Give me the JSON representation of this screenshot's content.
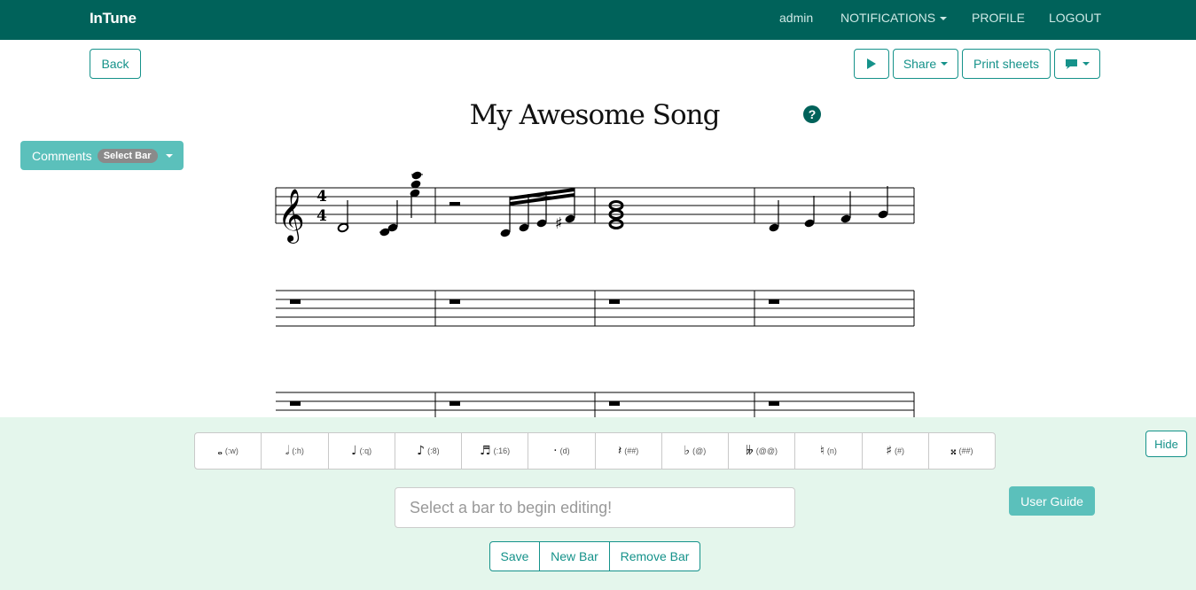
{
  "navbar": {
    "brand": "InTune",
    "user": "admin",
    "notifications": "NOTIFICATIONS",
    "profile": "PROFILE",
    "logout": "LOGOUT"
  },
  "toolbar": {
    "back": "Back",
    "share": "Share",
    "print": "Print sheets",
    "play_icon": "play-icon",
    "comment_icon": "comment-icon"
  },
  "song": {
    "title": "My Awesome Song",
    "help_glyph": "?"
  },
  "comments": {
    "label": "Comments",
    "badge": "Select Bar"
  },
  "score": {
    "time_signature": [
      "4",
      "4"
    ],
    "systems": 3,
    "bars_per_system": 4
  },
  "palette": [
    {
      "glyph": "𝅝",
      "label": "(:w)",
      "icon": "whole-note-icon"
    },
    {
      "glyph": "𝅗𝅥",
      "label": "(:h)",
      "icon": "half-note-icon"
    },
    {
      "glyph": "♩",
      "label": "(:q)",
      "icon": "quarter-note-icon"
    },
    {
      "glyph": "♪",
      "label": "(:8)",
      "icon": "eighth-note-icon"
    },
    {
      "glyph": "♬",
      "label": "(:16)",
      "icon": "sixteenth-note-icon"
    },
    {
      "glyph": "·",
      "label": "(d)",
      "icon": "dot-icon"
    },
    {
      "glyph": "𝄽",
      "label": "(##)",
      "icon": "rest-icon"
    },
    {
      "glyph": "♭",
      "label": "(@)",
      "icon": "flat-icon"
    },
    {
      "glyph": "𝄫",
      "label": "(@@)",
      "icon": "double-flat-icon"
    },
    {
      "glyph": "♮",
      "label": "(n)",
      "icon": "natural-icon"
    },
    {
      "glyph": "♯",
      "label": "(#)",
      "icon": "sharp-icon"
    },
    {
      "glyph": "𝄪",
      "label": "(##)",
      "icon": "double-sharp-icon"
    }
  ],
  "editor": {
    "placeholder": "Select a bar to begin editing!",
    "hide": "Hide",
    "user_guide": "User Guide",
    "save": "Save",
    "new_bar": "New Bar",
    "remove_bar": "Remove Bar"
  },
  "colors": {
    "navbar": "#00625a",
    "accent": "#15928a",
    "accent_light": "#5bc0bb",
    "editor_bg": "#e4f6ec"
  }
}
